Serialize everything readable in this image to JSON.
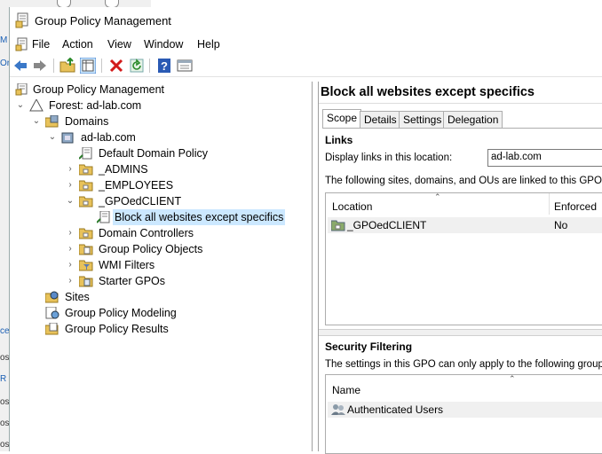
{
  "window": {
    "title": "Group Policy Management"
  },
  "menu": [
    "File",
    "Action",
    "View",
    "Window",
    "Help"
  ],
  "toolbar": [
    "back-icon",
    "forward-icon",
    "up-folder-icon",
    "show-hide-tree-icon",
    "delete-icon",
    "refresh-icon",
    "help-icon",
    "properties-icon"
  ],
  "background_window": {
    "fragments": [
      "M",
      "Or",
      "ce",
      "os",
      "R",
      "os",
      "os",
      "os"
    ]
  },
  "tree": {
    "root": "Group Policy Management",
    "forest": "Forest: ad-lab.com",
    "domains": "Domains",
    "domain": "ad-lab.com",
    "default_policy": "Default Domain Policy",
    "admins": "_ADMINS",
    "employees": "_EMPLOYEES",
    "gpoedclient": "_GPOedCLIENT",
    "selected_gpo": "Block all websites except specifics",
    "domain_controllers": "Domain Controllers",
    "gpo_objects": "Group Policy Objects",
    "wmi_filters": "WMI Filters",
    "starter_gpos": "Starter GPOs",
    "sites": "Sites",
    "modeling": "Group Policy Modeling",
    "results": "Group Policy Results"
  },
  "details": {
    "title": "Block all websites except specifics",
    "tabs": [
      "Scope",
      "Details",
      "Settings",
      "Delegation"
    ],
    "active_tab": "Scope",
    "links": {
      "heading": "Links",
      "display_label": "Display links in this location:",
      "display_value": "ad-lab.com",
      "linked_text": "The following sites, domains, and OUs are linked to this GPO:",
      "columns": [
        "Location",
        "Enforced"
      ],
      "rows": [
        {
          "location": "_GPOedCLIENT",
          "enforced": "No"
        }
      ]
    },
    "security": {
      "heading": "Security Filtering",
      "desc": "The settings in this GPO can only apply to the following groups, us",
      "columns": [
        "Name"
      ],
      "rows": [
        "Authenticated Users"
      ]
    }
  },
  "colors": {
    "selection": "#cce8ff",
    "folder": "#e8c25a",
    "link_arrow": "#2a7a2a"
  }
}
